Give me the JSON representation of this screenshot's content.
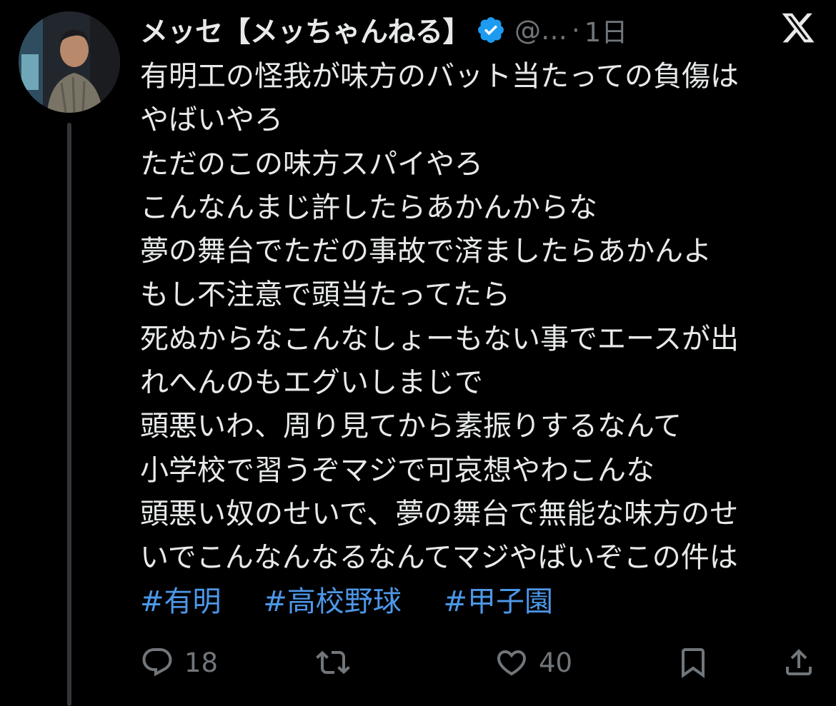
{
  "author": {
    "display_name": "メッセ【メッちゃんねる】",
    "handle": "@…",
    "separator": "·",
    "time": "1日",
    "verified": true,
    "avatar_icon": "profile-photo"
  },
  "brand_icon": "x-logo-icon",
  "tweet": {
    "lines": [
      "有明工の怪我が味方のバット当たっての負傷は",
      "やばいやろ",
      "ただのこの味方スパイやろ",
      "こんなんまじ許したらあかんからな",
      "夢の舞台でただの事故で済ましたらあかんよ",
      "もし不注意で頭当たってたら",
      "死ぬからなこんなしょーもない事でエースが出",
      "れへんのもエグいしまじで",
      "頭悪いわ、周り見てから素振りするなんて",
      "小学校で習うぞマジで可哀想やわこんな",
      "頭悪い奴のせいで、夢の舞台で無能な味方のせ",
      "いでこんなんなるなんてマジやばいぞこの件は"
    ],
    "hashtags": [
      "#有明",
      "#高校野球",
      "#甲子園"
    ]
  },
  "actions": {
    "reply": {
      "icon": "reply-icon",
      "count": "18"
    },
    "retweet": {
      "icon": "retweet-icon",
      "count": ""
    },
    "like": {
      "icon": "heart-icon",
      "count": "40"
    },
    "bookmark": {
      "icon": "bookmark-icon"
    },
    "share": {
      "icon": "share-icon"
    }
  },
  "colors": {
    "background": "#000000",
    "text": "#e7e9ea",
    "muted": "#71767b",
    "link": "#4d97e8",
    "verified": "#1d9bf0",
    "thread_line": "#333639"
  }
}
